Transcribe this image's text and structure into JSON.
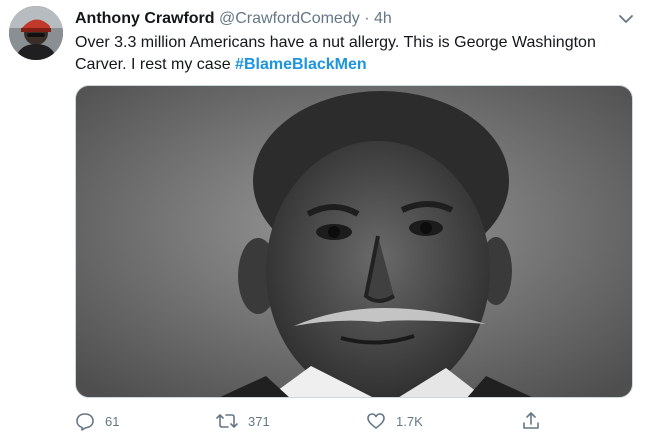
{
  "author": {
    "display_name": "Anthony Crawford",
    "handle": "@CrawfordComedy",
    "separator": "·",
    "time": "4h"
  },
  "tweet": {
    "text": "Over 3.3 million Americans have a nut allergy. This is George Washington Carver. I rest my case ",
    "hashtag": "#BlameBlackMen"
  },
  "actions": {
    "replies": "61",
    "retweets": "371",
    "likes": "1.7K"
  },
  "icons": {
    "menu": "chevron-down-icon",
    "reply": "reply-icon",
    "retweet": "retweet-icon",
    "like": "heart-icon",
    "share": "share-icon"
  },
  "colors": {
    "text": "#14171a",
    "muted": "#657786",
    "hashtag": "#1b95e0"
  }
}
